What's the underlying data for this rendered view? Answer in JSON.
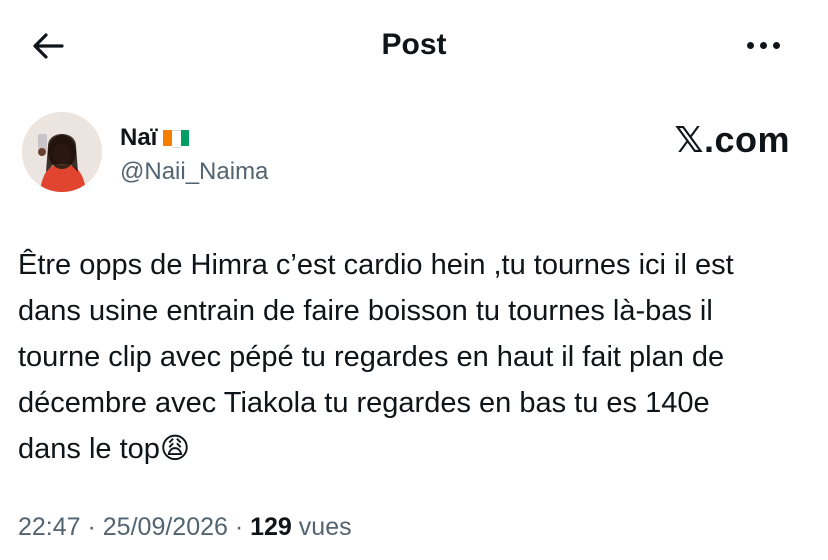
{
  "header": {
    "title": "Post",
    "back_icon": "arrow-left-icon",
    "more_icon": "more-dots-icon"
  },
  "author": {
    "name": "Naï",
    "flag": "ivory-coast-flag",
    "flag_colors": [
      "#f77f00",
      "#ffffff",
      "#009e60"
    ],
    "handle": "@Naii_Naima"
  },
  "brand": "𝕏.com",
  "tweet": {
    "lines": [
      "Être opps de Himra c’est cardio hein ,tu tournes ici il est",
      "dans usine entrain de faire boisson tu tournes là-bas il",
      "tourne clip avec pépé tu regardes en haut il fait plan de",
      "décembre avec Tiakola tu regardes en bas tu es 140e",
      "dans le top"
    ],
    "emoji": "😩"
  },
  "meta": {
    "time": "22:47",
    "sep1": " · ",
    "date": "25/09/2026",
    "sep2": " · ",
    "views": "129",
    "views_label": " vues"
  },
  "colors": {
    "text": "#0f1419",
    "secondary": "#536471"
  }
}
